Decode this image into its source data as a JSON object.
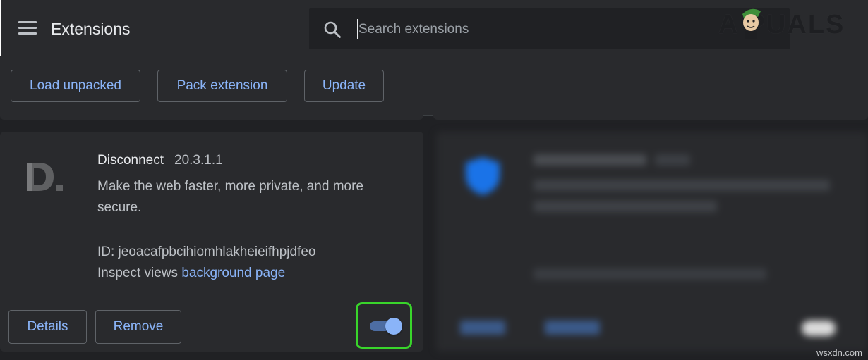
{
  "header": {
    "title": "Extensions",
    "search_placeholder": "Search extensions",
    "watermark": "A PUALS"
  },
  "toolbar": {
    "load_unpacked": "Load unpacked",
    "pack_extension": "Pack extension",
    "update": "Update"
  },
  "extension": {
    "name": "Disconnect",
    "version": "20.3.1.1",
    "description": "Make the web faster, more private, and more secure.",
    "id_text": "ID: jeoacafpbcihiomhlakheieifhpjdfeo",
    "inspect_label": "Inspect views",
    "inspect_link": "background page",
    "details_label": "Details",
    "remove_label": "Remove",
    "enabled": true
  },
  "footer": {
    "site": "wsxdn.com"
  },
  "colors": {
    "accent": "#8ab4f8",
    "highlight": "#39d52b",
    "background": "#202124",
    "surface": "#292a2d"
  },
  "icons": {
    "menu": "hamburger-menu-icon",
    "search": "search-icon",
    "extension_logo": "disconnect-logo"
  }
}
